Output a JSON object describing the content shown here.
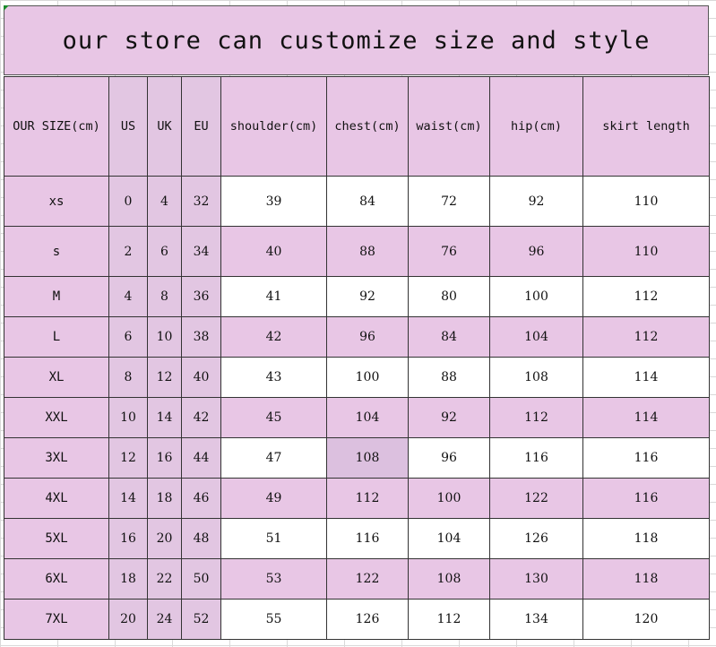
{
  "title": "our store can customize size and style",
  "headers": [
    "OUR SIZE(cm)",
    "US",
    "UK",
    "EU",
    "shoulder(cm)",
    "chest(cm)",
    "waist(cm)",
    "hip(cm)",
    "skirt length"
  ],
  "rows": [
    [
      "xs",
      "0",
      "4",
      "32",
      "39",
      "84",
      "72",
      "92",
      "110"
    ],
    [
      "s",
      "2",
      "6",
      "34",
      "40",
      "88",
      "76",
      "96",
      "110"
    ],
    [
      "M",
      "4",
      "8",
      "36",
      "41",
      "92",
      "80",
      "100",
      "112"
    ],
    [
      "L",
      "6",
      "10",
      "38",
      "42",
      "96",
      "84",
      "104",
      "112"
    ],
    [
      "XL",
      "8",
      "12",
      "40",
      "43",
      "100",
      "88",
      "108",
      "114"
    ],
    [
      "XXL",
      "10",
      "14",
      "42",
      "45",
      "104",
      "92",
      "112",
      "114"
    ],
    [
      "3XL",
      "12",
      "16",
      "44",
      "47",
      "108",
      "96",
      "116",
      "116"
    ],
    [
      "4XL",
      "14",
      "18",
      "46",
      "49",
      "112",
      "100",
      "122",
      "116"
    ],
    [
      "5XL",
      "16",
      "20",
      "48",
      "51",
      "116",
      "104",
      "126",
      "118"
    ],
    [
      "6XL",
      "18",
      "22",
      "50",
      "53",
      "122",
      "108",
      "130",
      "118"
    ],
    [
      "7XL",
      "20",
      "24",
      "52",
      "55",
      "126",
      "112",
      "134",
      "120"
    ]
  ],
  "colors": {
    "header_pink": "#e8c6e5",
    "size_col_pink": "#e2c6e2",
    "row_white": "#ffffff",
    "border": "#333333"
  }
}
